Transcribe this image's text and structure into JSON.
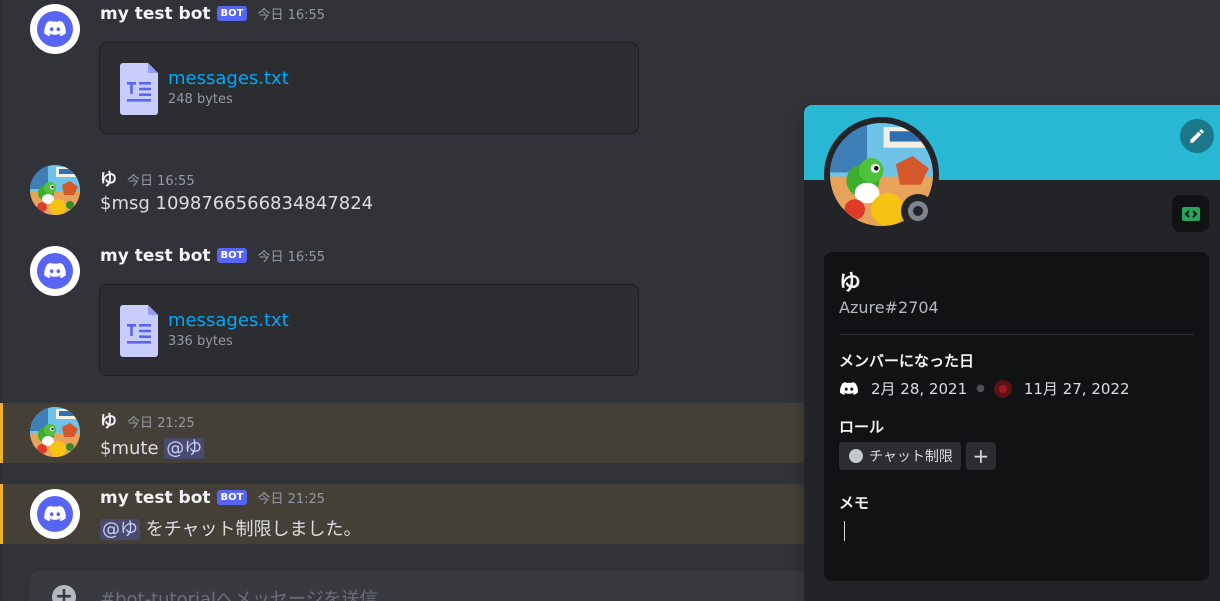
{
  "messages": [
    {
      "author": "my test bot",
      "bot_tag": "BOT",
      "timestamp": "今日 16:55",
      "attachment": {
        "name": "messages.txt",
        "size": "248 bytes"
      }
    },
    {
      "author": "ゆ",
      "timestamp": "今日 16:55",
      "text": "$msg 1098766566834847824"
    },
    {
      "author": "my test bot",
      "bot_tag": "BOT",
      "timestamp": "今日 16:55",
      "attachment": {
        "name": "messages.txt",
        "size": "336 bytes"
      }
    },
    {
      "author": "ゆ",
      "timestamp": "今日 21:25",
      "text_prefix": "$mute ",
      "mention": "@ゆ"
    },
    {
      "author": "my test bot",
      "bot_tag": "BOT",
      "timestamp": "今日 21:25",
      "mention": "@ゆ",
      "text_suffix": " をチャット制限しました。"
    }
  ],
  "input": {
    "placeholder": "#bot-tutorialへメッセージを送信"
  },
  "profile": {
    "display_name": "ゆ",
    "tag": "Azure#2704",
    "member_since_title": "メンバーになった日",
    "discord_since": "2月 28, 2021",
    "server_since": "11月 27, 2022",
    "roles_title": "ロール",
    "roles": [
      "チャット制限"
    ],
    "add_role_symbol": "+",
    "note_title": "メモ",
    "status": "offline",
    "banner_color": "#28b8d4"
  },
  "icons": [
    "discord-logo-icon",
    "text-file-icon",
    "pencil-icon",
    "developer-badge-icon",
    "add-circle-icon",
    "plus-icon",
    "server-icon"
  ]
}
